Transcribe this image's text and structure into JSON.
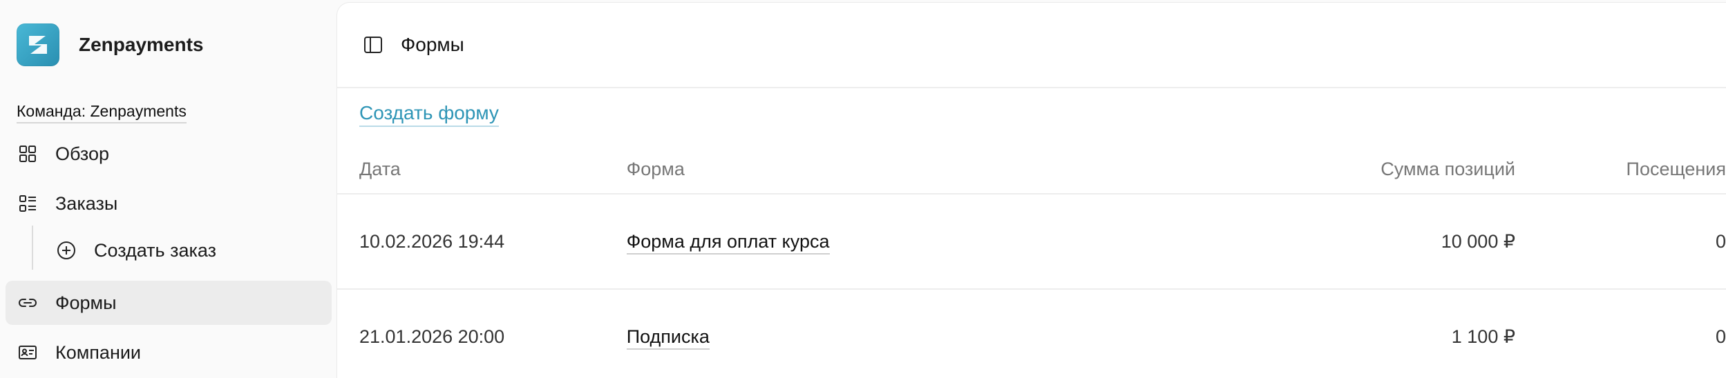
{
  "brand": {
    "name": "Zenpayments",
    "accent": "#2e95b6"
  },
  "sidebar": {
    "team_label": "Команда: Zenpayments",
    "items": [
      {
        "label": "Обзор",
        "icon": "grid-icon"
      },
      {
        "label": "Заказы",
        "icon": "list-icon"
      },
      {
        "label": "Создать заказ",
        "icon": "plus-circle-icon"
      },
      {
        "label": "Формы",
        "icon": "link-icon",
        "active": true
      },
      {
        "label": "Компании",
        "icon": "id-card-icon"
      }
    ]
  },
  "header": {
    "title": "Формы"
  },
  "main": {
    "create_label": "Создать форму",
    "columns": [
      "Дата",
      "Форма",
      "Сумма позиций",
      "Посещения"
    ],
    "rows": [
      {
        "date": "10.02.2026 19:44",
        "form": "Форма для оплат курса",
        "sum": "10 000 ₽",
        "visits": "0"
      },
      {
        "date": "21.01.2026 20:00",
        "form": "Подписка",
        "sum": "1 100 ₽",
        "visits": "0"
      }
    ]
  }
}
